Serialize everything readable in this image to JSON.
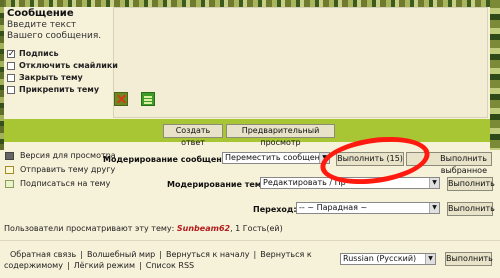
{
  "reply_form": {
    "heading": "Сообщение",
    "hint": "Введите текст Вашего сообщения.",
    "options": [
      {
        "label": "Подпись",
        "checked": true
      },
      {
        "label": "Отключить смайлики",
        "checked": false
      },
      {
        "label": "Закрыть тему",
        "checked": false
      },
      {
        "label": "Прикрепить тему",
        "checked": false
      }
    ],
    "submit_label": "Создать ответ",
    "preview_label": "Предварительный просмотр"
  },
  "side_links": {
    "print": "Версия для просмотра",
    "send_friend": "Отправить тему другу",
    "subscribe": "Подписаться на тему"
  },
  "moderation": {
    "message_label": "Модерирование сообщения:",
    "message_action": "Переместить сообщения",
    "execute_count_label": "Выполнить (15)",
    "execute_selected_label": "Выполнить выбранное",
    "topic_label": "Модерирование темы:",
    "topic_action": "Редактировать / Пр",
    "execute_label": "Выполнить"
  },
  "jump": {
    "label": "Переход:",
    "value": "-- ~ Парадная ~",
    "execute_label": "Выполнить"
  },
  "viewers": {
    "prefix": "Пользователи просматривают эту тему:",
    "user": "Sunbeam62",
    "suffix": ", 1 Гость(ей)"
  },
  "footer": {
    "links": [
      "Обратная связь",
      "Волшебный мир",
      "Вернуться к началу",
      "Вернуться к содержимому",
      "Лёгкий режим",
      "Список RSS"
    ],
    "language": "Russian (Русский)",
    "execute_label": "Выполнить"
  },
  "colors": {
    "accent_green": "#a8c533",
    "background": "#f6f1d9",
    "highlight_red": "#ff1a10",
    "username": "#b31b1b"
  }
}
